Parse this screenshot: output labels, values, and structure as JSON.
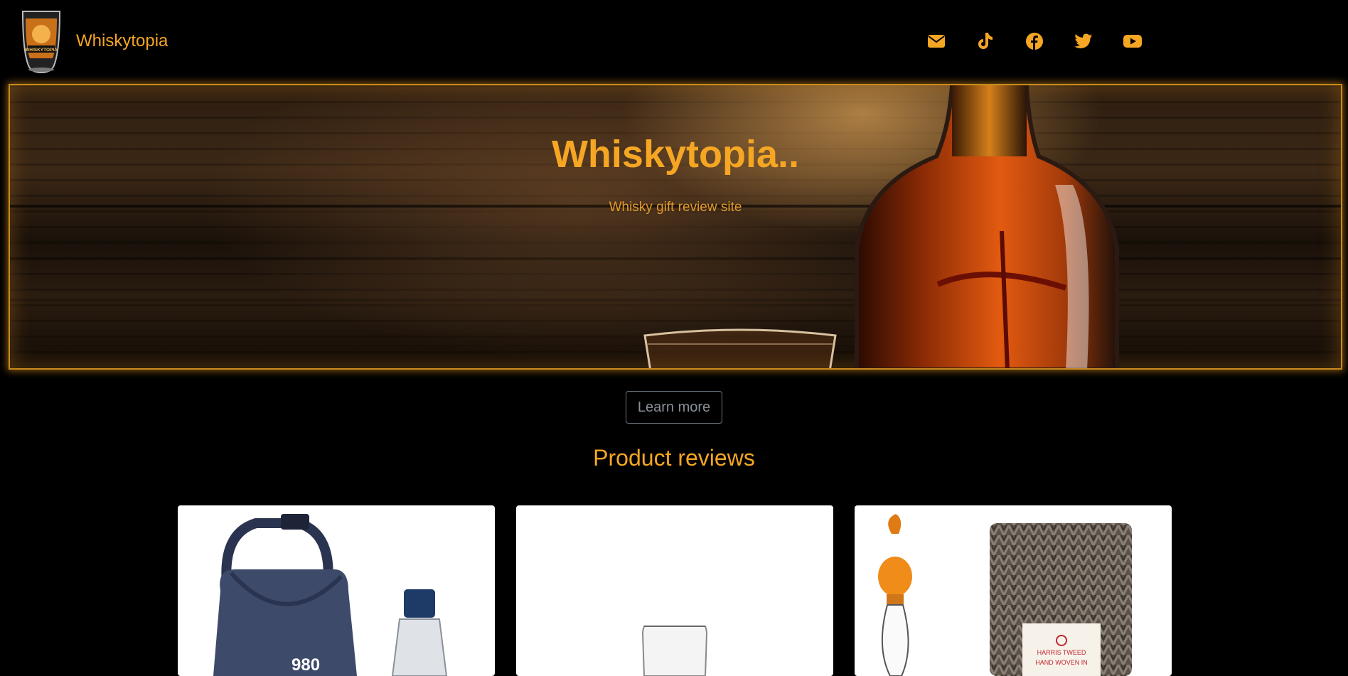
{
  "brand": {
    "name": "Whiskytopia",
    "logo_icon": "whisky-glass-logo",
    "logo_text": "WHISKYTOPIA"
  },
  "social": [
    {
      "name": "email",
      "icon": "envelope-icon"
    },
    {
      "name": "tiktok",
      "icon": "tiktok-icon"
    },
    {
      "name": "facebook",
      "icon": "facebook-icon"
    },
    {
      "name": "twitter",
      "icon": "twitter-icon"
    },
    {
      "name": "youtube",
      "icon": "youtube-icon"
    }
  ],
  "hero": {
    "title": "Whiskytopia..",
    "subtitle": "Whisky gift review site"
  },
  "cta": {
    "learn_more": "Learn more"
  },
  "reviews": {
    "heading": "Product reviews",
    "cards": [
      {
        "image": "cooler-bag-with-bottle",
        "visible_text": "980"
      },
      {
        "image": "nosing-glass"
      },
      {
        "image": "decanter-and-tweed-sleeve",
        "label_text": "HARRIS TWEED",
        "label_sub": "HAND WOVEN IN"
      }
    ]
  },
  "colors": {
    "accent": "#f5a623",
    "background": "#000000",
    "button_border": "#6c757d"
  }
}
